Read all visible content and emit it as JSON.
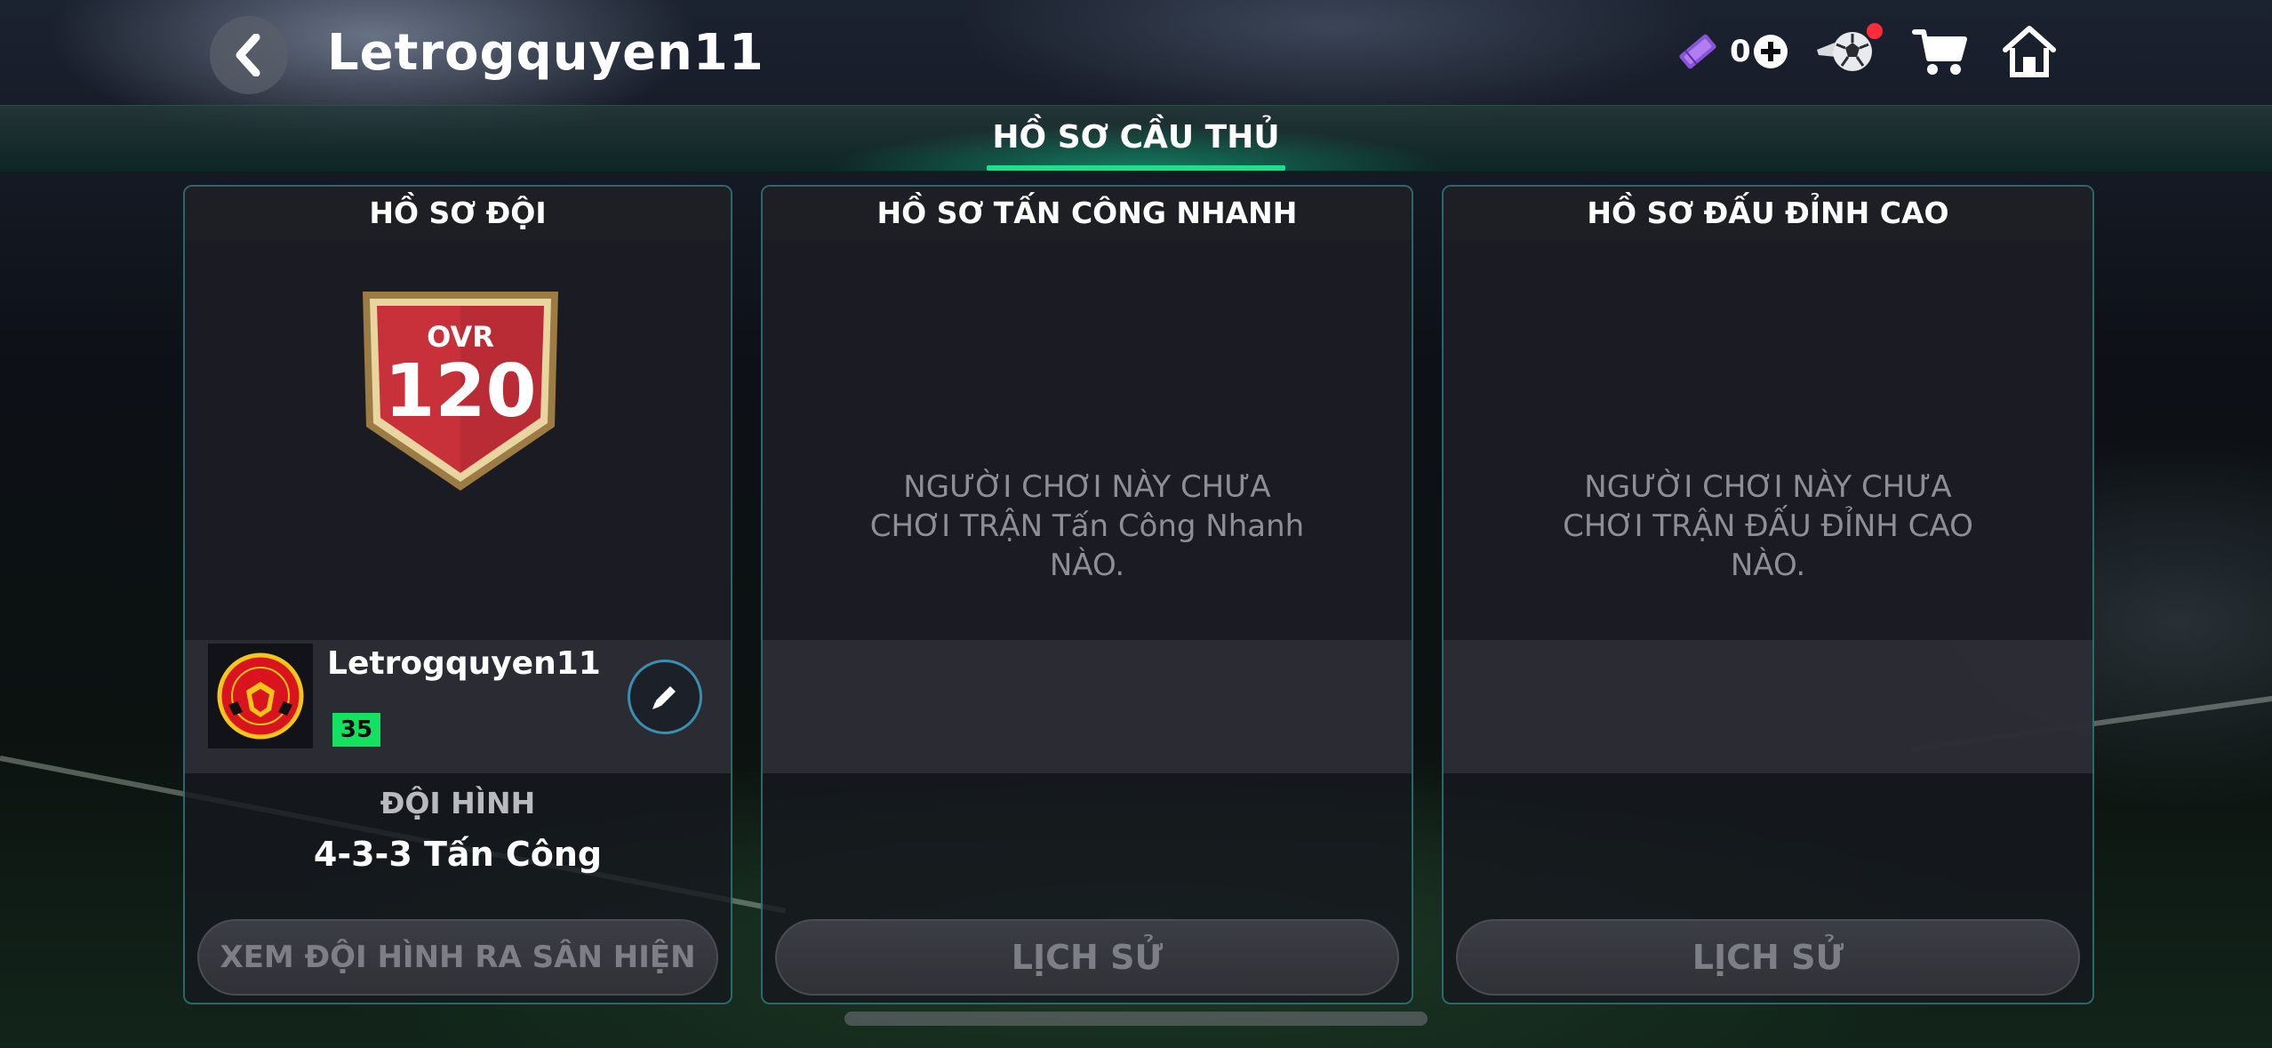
{
  "top_bar": {
    "username": "Letrogquyen11",
    "coins": "0",
    "icons": [
      "back-icon",
      "ticket-icon",
      "add-icon",
      "ball-icon",
      "cart-icon",
      "home-icon"
    ]
  },
  "header": {
    "title": "HỒ SƠ CẦU THỦ"
  },
  "team_panel": {
    "title": "HỒ SƠ ĐỘI",
    "ovr_label": "OVR",
    "ovr_value": "120",
    "username": "Letrogquyen11",
    "level": "35",
    "club_logo_text": "MANCHESTER UNITED",
    "formation_label": "ĐỘI HÌNH",
    "formation_value": "4-3-3 Tấn Công",
    "view_button": "XEM ĐỘI HÌNH RA SÂN HIỆN TẠI"
  },
  "quick_panel": {
    "title": "HỒ SƠ TẤN CÔNG NHANH",
    "empty_message": "NGƯỜI CHƠI NÀY CHƯA\nCHƠI TRẬN Tấn Công Nhanh\nNÀO.",
    "history_button": "LỊCH SỬ"
  },
  "elite_panel": {
    "title": "HỒ SƠ ĐẤU ĐỈNH CAO",
    "empty_message": "NGƯỜI CHƠI NÀY CHƯA\nCHƠI TRẬN ĐẤU ĐỈNH CAO\nNÀO.",
    "history_button": "LỊCH SỬ"
  },
  "colors": {
    "accent_green": "#1ee08c",
    "level_green": "#14e15f",
    "panel_border": "#3caaaa",
    "badge_red": "#c8313a"
  }
}
